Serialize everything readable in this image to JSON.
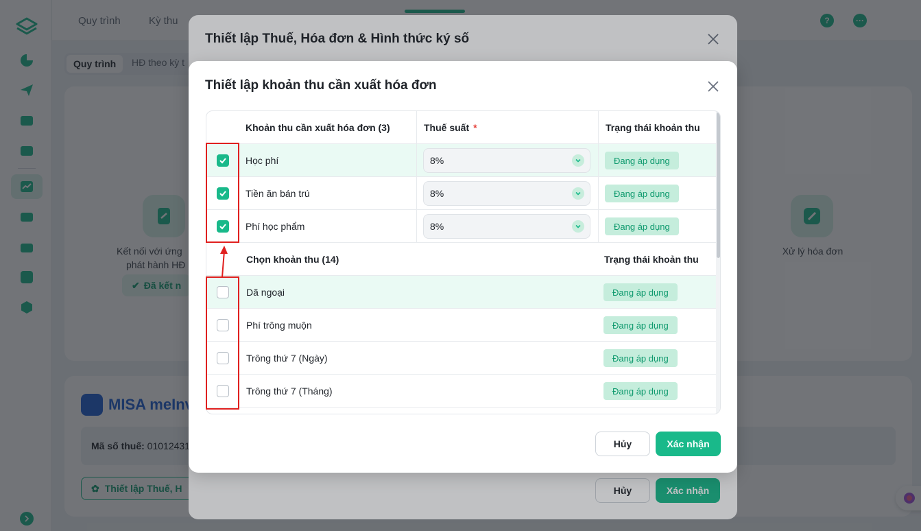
{
  "topbar": {
    "nav": [
      "Quy trình",
      "Kỳ thu"
    ],
    "help_icon": "question-icon",
    "more_icon": "more-icon"
  },
  "subtabs": [
    "Quy trình",
    "HĐ theo kỳ t"
  ],
  "steps": {
    "connect_label": "Kết nối với ứng",
    "connect_label2": "phát hành HĐ",
    "connected": "Đã kết n",
    "process_label": "Xử lý hóa đơn"
  },
  "misa": {
    "brand": "MISA meInv"
  },
  "tax": {
    "label": "Mã số thuế:",
    "value": "01012431"
  },
  "settings_button": "Thiết lập Thuế, H",
  "outer_dialog": {
    "title": "Thiết lập Thuế, Hóa đơn & Hình thức ký số",
    "cancel": "Hủy",
    "confirm": "Xác nhận"
  },
  "inner_dialog": {
    "title": "Thiết lập khoản thu cần xuất hóa đơn",
    "header": {
      "col_item": "Khoản thu cần xuất hóa đơn (3)",
      "col_tax": "Thuế suất",
      "required_mark": "*",
      "col_status": "Trạng thái khoản thu"
    },
    "selected": [
      {
        "name": "Học phí",
        "tax": "8%",
        "status": "Đang áp dụng",
        "checked": true
      },
      {
        "name": "Tiền ăn bán trú",
        "tax": "8%",
        "status": "Đang áp dụng",
        "checked": true
      },
      {
        "name": "Phí học phẩm",
        "tax": "8%",
        "status": "Đang áp dụng",
        "checked": true
      }
    ],
    "subheader": {
      "col_item": "Chọn khoản thu (14)",
      "col_status": "Trạng thái khoản thu"
    },
    "available": [
      {
        "name": "Dã ngoại",
        "status": "Đang áp dụng",
        "checked": false
      },
      {
        "name": "Phí trông muộn",
        "status": "Đang áp dụng",
        "checked": false
      },
      {
        "name": "Trông thứ 7 (Ngày)",
        "status": "Đang áp dụng",
        "checked": false
      },
      {
        "name": "Trông thứ 7 (Tháng)",
        "status": "Đang áp dụng",
        "checked": false
      }
    ],
    "cancel": "Hủy",
    "confirm": "Xác nhận"
  },
  "colors": {
    "accent": "#19b98a",
    "badge_bg": "#c5eddc",
    "annotation": "#e0201f"
  }
}
